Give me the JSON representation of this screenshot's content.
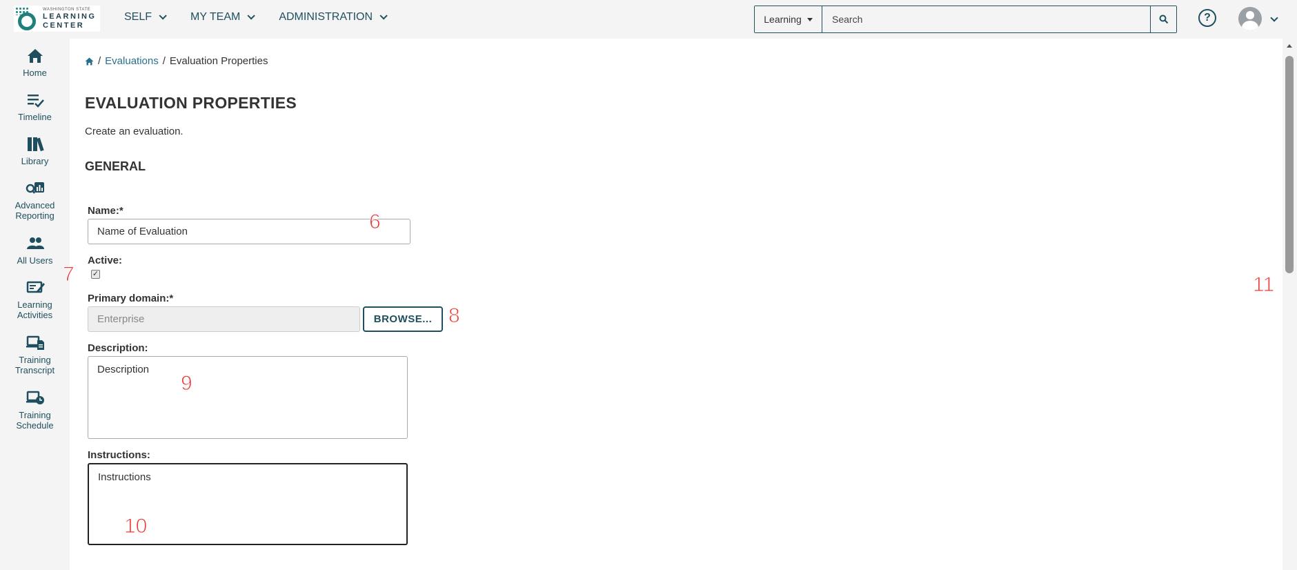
{
  "header": {
    "logo_small": "WASHINGTON STATE",
    "logo_line1": "LEARNING",
    "logo_line2": "CENTER",
    "nav": [
      "SELF",
      "MY TEAM",
      "ADMINISTRATION"
    ],
    "search_category": "Learning",
    "search_placeholder": "Search",
    "help_symbol": "?"
  },
  "sidebar": {
    "items": [
      {
        "label": "Home",
        "icon": "home-icon"
      },
      {
        "label": "Timeline",
        "icon": "timeline-icon"
      },
      {
        "label": "Library",
        "icon": "library-icon"
      },
      {
        "label": "Advanced Reporting",
        "icon": "reporting-icon"
      },
      {
        "label": "All Users",
        "icon": "users-icon"
      },
      {
        "label": "Learning Activities",
        "icon": "learning-activities-icon"
      },
      {
        "label": "Training Transcript",
        "icon": "transcript-icon"
      },
      {
        "label": "Training Schedule",
        "icon": "schedule-icon"
      }
    ]
  },
  "breadcrumb": {
    "link": "Evaluations",
    "current": "Evaluation Properties",
    "separator": "/"
  },
  "page": {
    "title": "EVALUATION PROPERTIES",
    "subtitle": "Create an evaluation.",
    "section": "GENERAL"
  },
  "form": {
    "name_label": "Name:*",
    "name_value": "Name of Evaluation",
    "active_label": "Active:",
    "active_checked": true,
    "domain_label": "Primary domain:*",
    "domain_value": "Enterprise",
    "browse_label": "BROWSE...",
    "description_label": "Description:",
    "description_value": "Description",
    "instructions_label": "Instructions:",
    "instructions_value": "Instructions"
  },
  "markers": [
    "6",
    "7",
    "8",
    "9",
    "10",
    "11"
  ],
  "colors": {
    "brand": "#1f4f5f",
    "link": "#2a6f8f",
    "marker": "#e53935"
  }
}
